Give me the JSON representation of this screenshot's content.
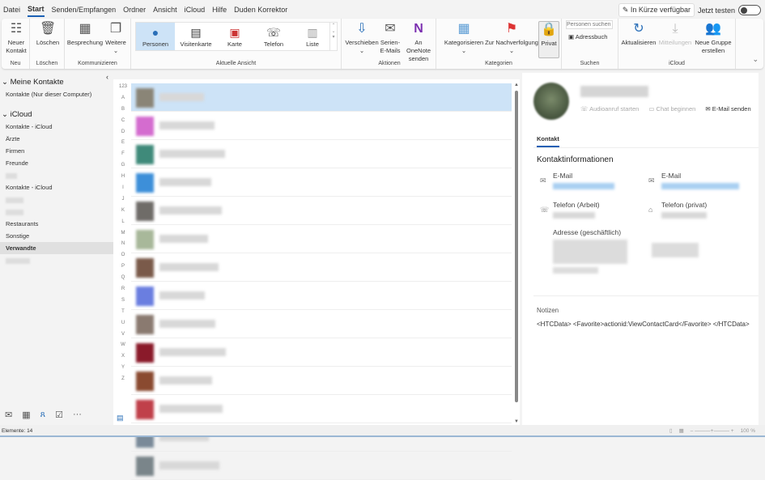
{
  "menu": [
    "Datei",
    "Start",
    "Senden/Empfangen",
    "Ordner",
    "Ansicht",
    "iCloud",
    "Hilfe",
    "Duden Korrektor"
  ],
  "soon": {
    "label": "In Kürze verfügbar",
    "try": "Jetzt testen"
  },
  "ribbon": {
    "neu": {
      "btn": "Neuer Kontakt",
      "group": "Neu"
    },
    "loeschen": {
      "btn": "Löschen",
      "group": "Löschen"
    },
    "komm": {
      "b1": "Besprechung",
      "b2": "Weitere",
      "group": "Kommunizieren"
    },
    "ansicht": {
      "items": [
        "Personen",
        "Visitenkarte",
        "Karte",
        "Telefon",
        "Liste"
      ],
      "group": "Aktuelle Ansicht"
    },
    "aktionen": {
      "b1": "Verschieben",
      "b2": "Serien-E-Mails",
      "b3": "An OneNote senden",
      "group": "Aktionen"
    },
    "kategorien": {
      "b1": "Kategorisieren",
      "b2": "Zur Nachverfolgung",
      "b3": "Privat",
      "group": "Kategorien"
    },
    "suchen": {
      "placeholder": "Personen suchen",
      "b1": "Adressbuch",
      "group": "Suchen"
    },
    "icloud": {
      "b1": "Aktualisieren",
      "b2": "Mitteilungen",
      "b3": "Neue Gruppe erstellen",
      "group": "iCloud"
    }
  },
  "nav": {
    "h1": "Meine Kontakte",
    "i1": "Kontakte (Nur dieser Computer)",
    "h2": "iCloud",
    "items": [
      "Kontakte - iCloud",
      "Ärzte",
      "Firmen",
      "Freunde",
      "",
      "Kontakte - iCloud",
      "",
      "",
      "Restaurants",
      "Sonstige",
      "Verwandte",
      ""
    ]
  },
  "alpha": [
    "123",
    "A",
    "B",
    "C",
    "D",
    "E",
    "F",
    "G",
    "H",
    "I",
    "J",
    "K",
    "L",
    "M",
    "N",
    "O",
    "P",
    "Q",
    "R",
    "S",
    "T",
    "U",
    "V",
    "W",
    "X",
    "Y",
    "Z"
  ],
  "contacts_count": 14,
  "pane": {
    "actions": [
      "Audioanruf starten",
      "Chat beginnen",
      "E-Mail senden"
    ],
    "tab": "Kontakt",
    "section": "Kontaktinformationen",
    "f_email": "E-Mail",
    "f_tel_work": "Telefon (Arbeit)",
    "f_tel_home": "Telefon (privat)",
    "f_addr": "Adresse (geschäftlich)",
    "notes_label": "Notizen",
    "notes": "<HTCData> <Favorite>actionid:ViewContactCard</Favorite> </HTCData>"
  },
  "status": {
    "items": "Elemente: 14",
    "zoom": "100 %"
  },
  "colors": {
    "accent": "#1a5fb4",
    "selected": "#cde3f7"
  }
}
